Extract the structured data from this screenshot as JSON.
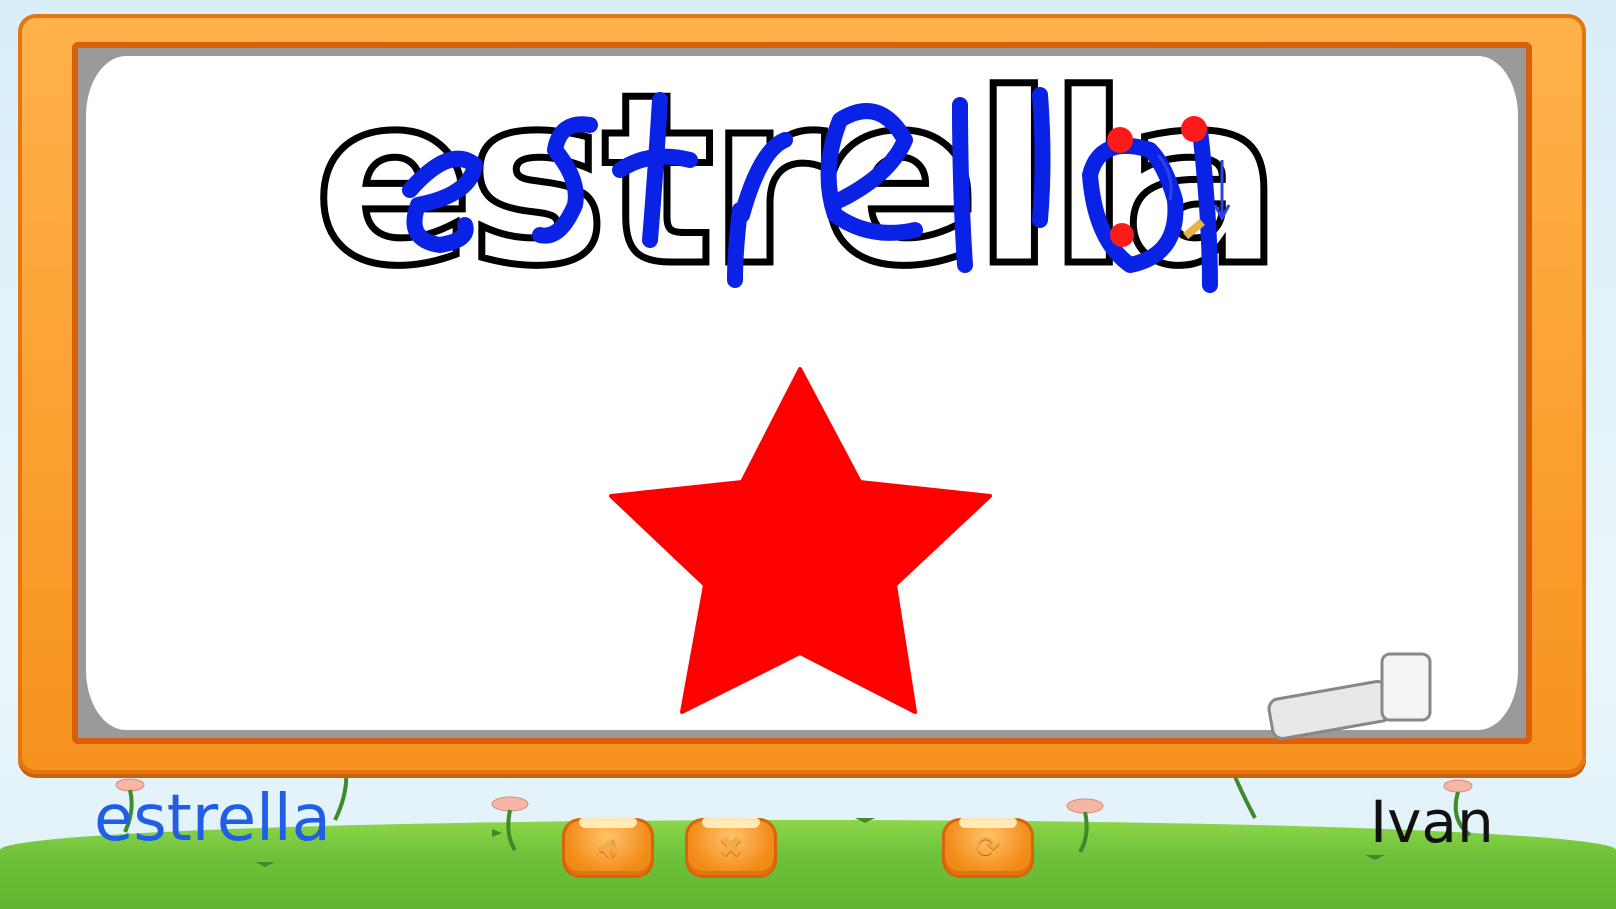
{
  "app": {
    "target_word_outline": "estrella",
    "bottom_word": "estrella",
    "student_name": "Ivan"
  },
  "colors": {
    "frame_orange": "#f7921e",
    "trace_blue": "#0a22e6",
    "star_red": "#ff0000",
    "word_blue": "#1f5ee5"
  },
  "controls": {
    "sound_icon": "speaker-icon",
    "close_icon": "x-icon",
    "refresh_icon": "refresh-icon"
  },
  "items": {
    "picture_icon": "star-icon",
    "eraser_icon": "eraser-icon"
  }
}
